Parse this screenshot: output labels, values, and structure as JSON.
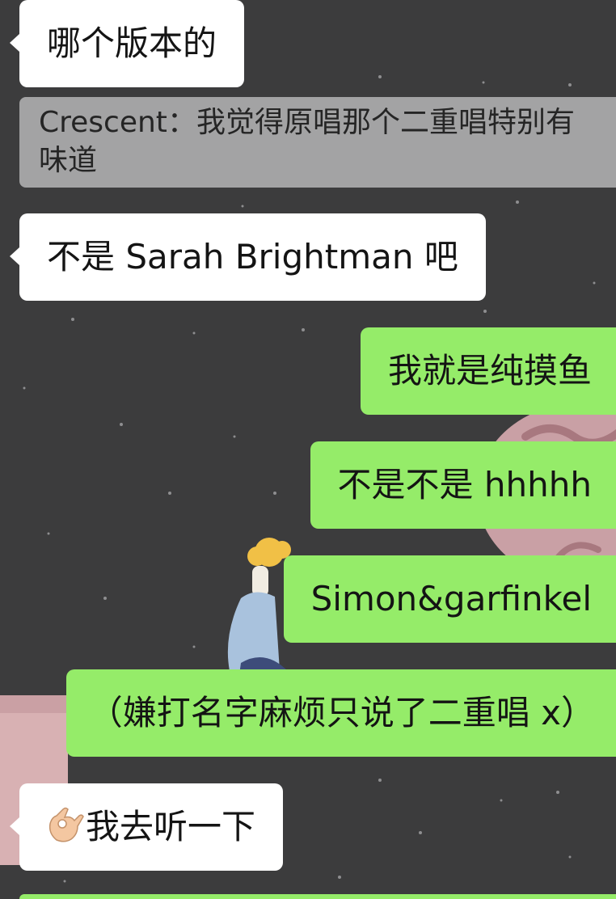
{
  "chat": {
    "messages": [
      {
        "side": "left",
        "text": "哪个版本的"
      },
      {
        "side": "quote",
        "sender": "Crescent",
        "separator": "：",
        "text": "我觉得原唱那个二重唱特别有味道"
      },
      {
        "side": "left",
        "text": "不是 Sarah Brightman 吧"
      },
      {
        "side": "right",
        "text": "我就是纯摸鱼"
      },
      {
        "side": "right",
        "text": "不是不是 hhhhh"
      },
      {
        "side": "right",
        "text": "Simon&garfinkel"
      },
      {
        "side": "right",
        "text": "（嫌打名字麻烦只说了二重唱 x）"
      },
      {
        "side": "left",
        "emoji": "ok-hand-emoji",
        "text": "我去听一下"
      }
    ]
  },
  "colors": {
    "background": "#3c3c3d",
    "incoming_bubble": "#ffffff",
    "outgoing_bubble": "#95ec69",
    "quote_bubble": "#a3a3a4"
  }
}
